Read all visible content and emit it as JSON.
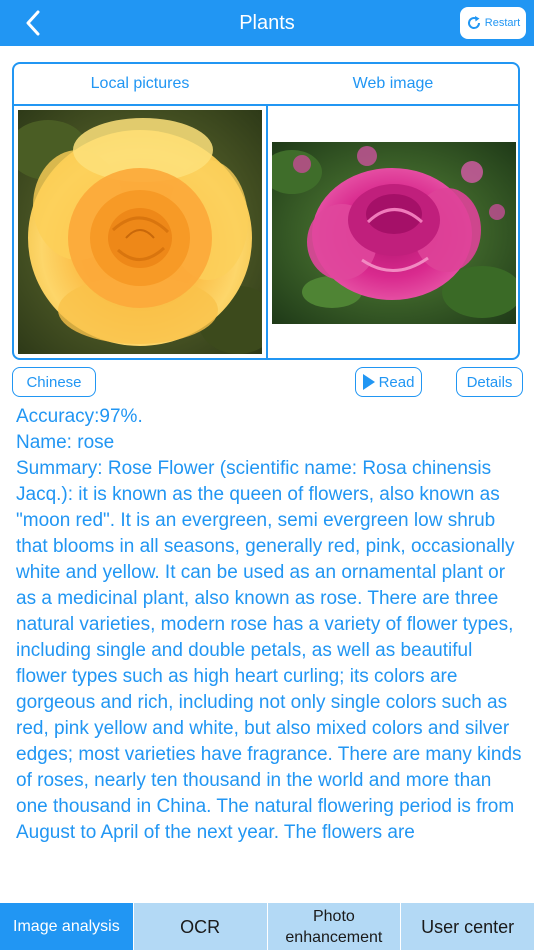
{
  "nav": {
    "title": "Plants",
    "restart_label": "Restart"
  },
  "source_tabs": {
    "local": "Local pictures",
    "web": "Web image"
  },
  "actions": {
    "language": "Chinese",
    "read": "Read",
    "details": "Details"
  },
  "result": {
    "accuracy": "Accuracy:97%.",
    "name": "Name: rose",
    "summary": "Summary: Rose Flower (scientific name: Rosa chinensis Jacq.): it is known as the queen of flowers, also known as \"moon red\". It is an evergreen, semi evergreen low shrub that blooms in all seasons, generally red, pink, occasionally white and yellow. It can be used as an ornamental plant or as a medicinal plant, also known as rose. There are three natural varieties, modern rose has a variety of flower types, including single and double petals, as well as beautiful flower types such as high heart curling; its colors are gorgeous and rich, including not only single colors such as red, pink yellow and white, but also mixed colors and silver edges; most varieties have fragrance. There are many kinds of roses, nearly ten thousand in the world and more than one thousand in China. The natural flowering period is from August to April of the next year. The flowers are"
  },
  "tabbar": {
    "items": [
      "Image analysis",
      "OCR",
      "Photo enhancement",
      "User center"
    ],
    "active": "Image analysis"
  },
  "colors": {
    "accent": "#2196f3",
    "tab_inactive": "#b3d9f5"
  }
}
